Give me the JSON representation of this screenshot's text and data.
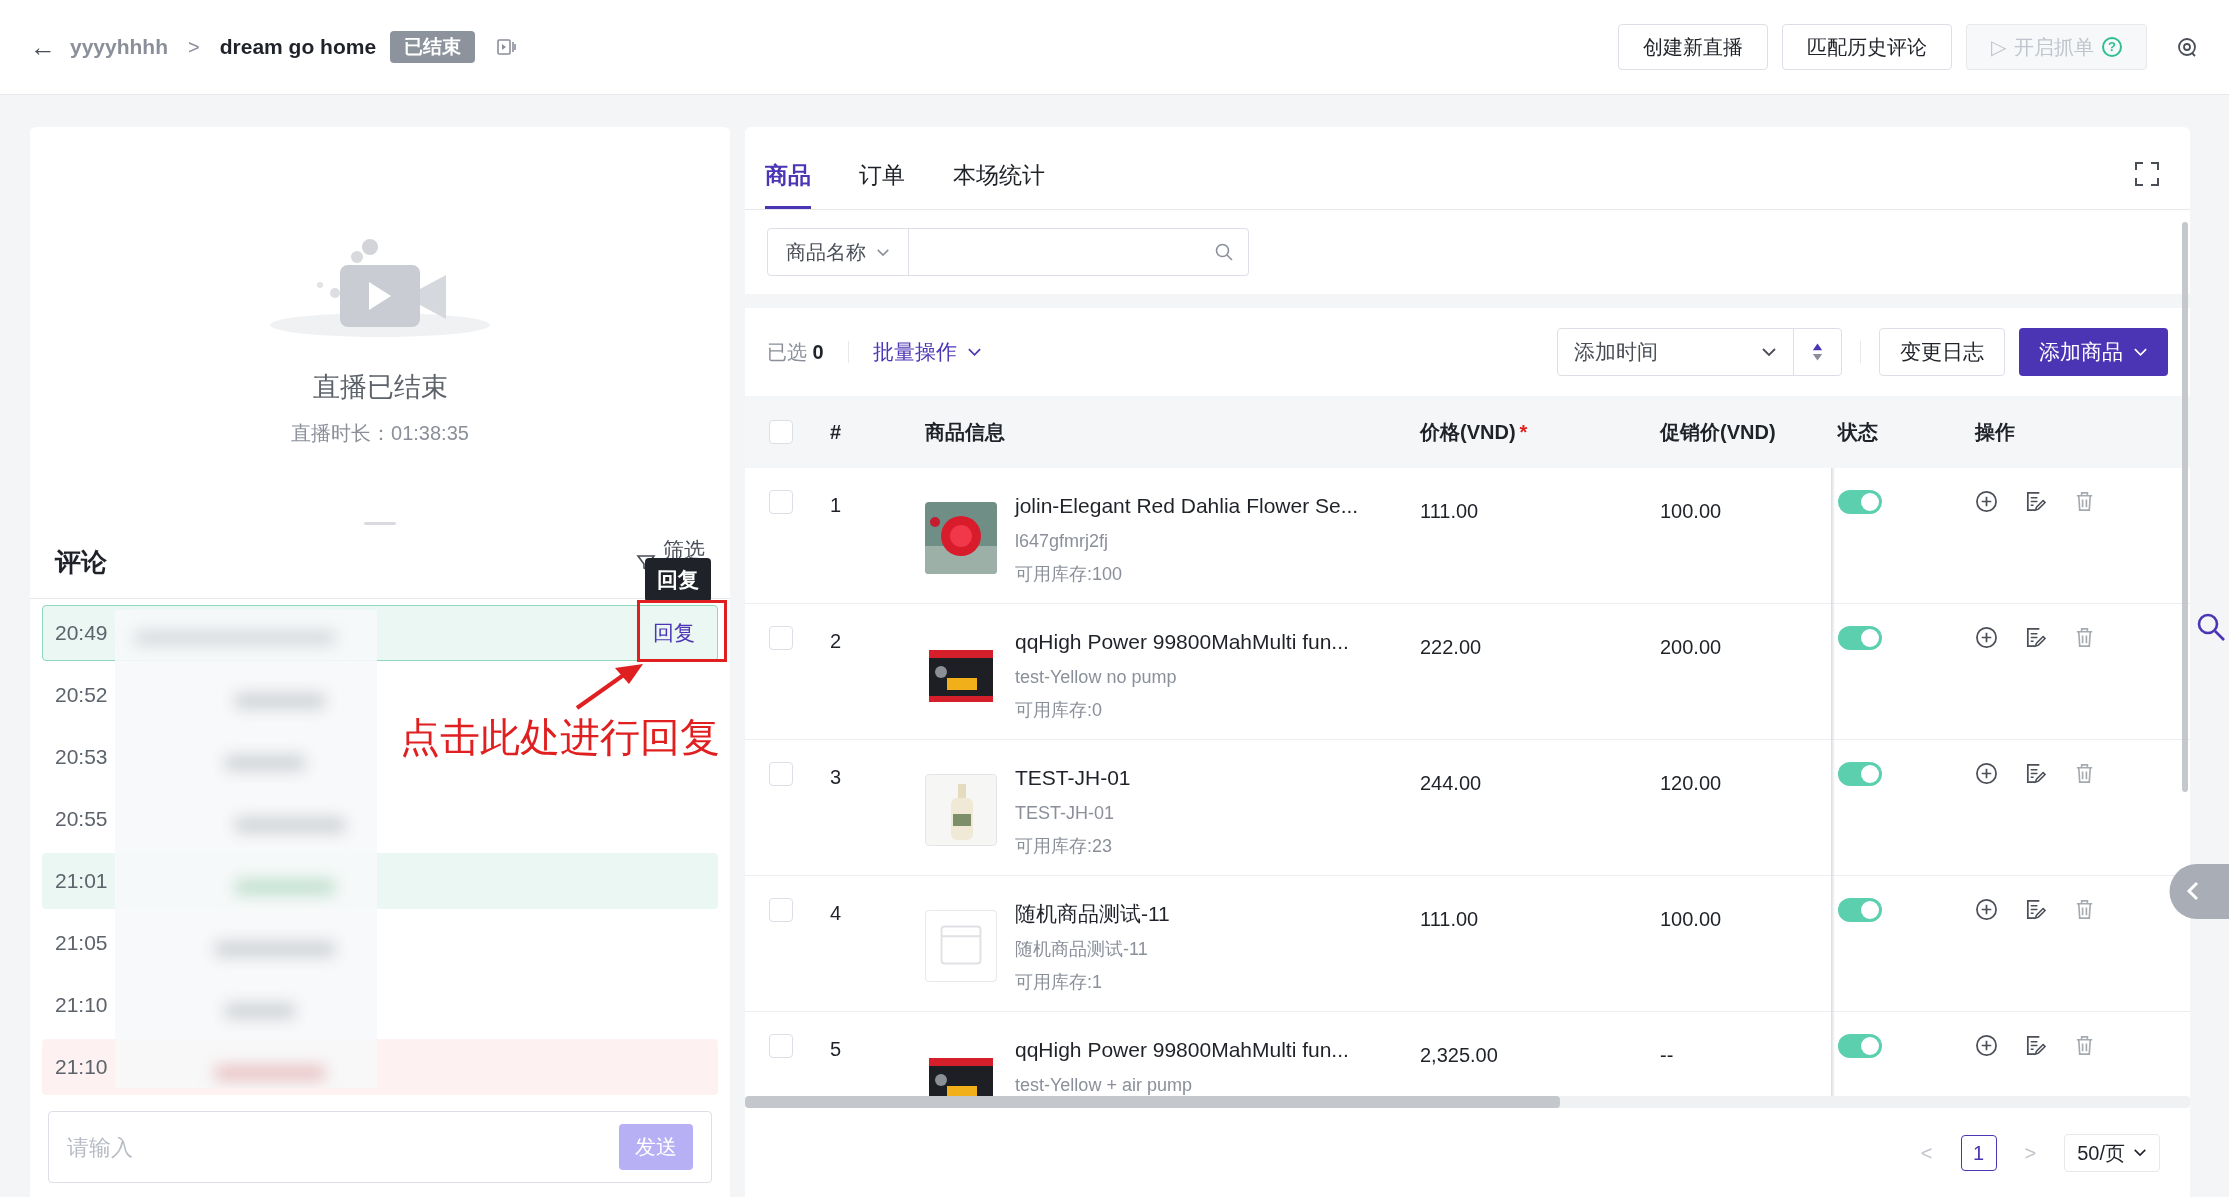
{
  "header": {
    "back": "←",
    "breadcrumb": "yyyyhhhh",
    "separator": ">",
    "title": "dream go home",
    "badge": "已结束",
    "buttons": [
      {
        "label": "创建新直播",
        "disabled": false
      },
      {
        "label": "匹配历史评论",
        "disabled": false
      },
      {
        "label": "开启抓单",
        "disabled": true,
        "icon": "▷",
        "help": "?"
      }
    ]
  },
  "live": {
    "status": "直播已结束",
    "duration": "直播时长：01:38:35"
  },
  "comments": {
    "title": "评论",
    "filter": "筛选",
    "tooltip": "回复",
    "reply": "回复",
    "items": [
      {
        "time": "20:49",
        "selected": true,
        "color": "#eaf7f2"
      },
      {
        "time": "20:52",
        "selected": false
      },
      {
        "time": "20:53",
        "selected": false
      },
      {
        "time": "20:55",
        "selected": false
      },
      {
        "time": "21:01",
        "selected": false,
        "color": "#eaf7f2"
      },
      {
        "time": "21:05",
        "selected": false
      },
      {
        "time": "21:10",
        "selected": false
      },
      {
        "time": "21:10",
        "selected": false,
        "color": "#fdf1f1"
      }
    ],
    "input_placeholder": "请输入",
    "send": "发送",
    "send_disabled": true
  },
  "annotation": {
    "text": "点击此处进行回复"
  },
  "tabs": [
    {
      "label": "商品",
      "selected": true
    },
    {
      "label": "订单",
      "selected": false
    },
    {
      "label": "本场统计",
      "selected": false
    }
  ],
  "search": {
    "field": "商品名称"
  },
  "toolbar": {
    "selected_label": "已选",
    "selected_count": "0",
    "batch": "批量操作",
    "sort": "添加时间",
    "log": "变更日志",
    "add": "添加商品"
  },
  "table": {
    "all_checked": false,
    "columns": [
      "#",
      "商品信息",
      "价格(VND)",
      "促销价(VND)",
      "状态",
      "操作"
    ],
    "required_mark": "*",
    "rows": [
      {
        "checked": false,
        "index": "1",
        "name": "jolin-Elegant Red Dahlia Flower Se...",
        "sku": "l647gfmrj2fj",
        "stock": "可用库存:100",
        "price": "111.00",
        "promo": "100.00",
        "on": true,
        "kind": "picture"
      },
      {
        "checked": false,
        "index": "2",
        "name": "qqHigh Power 99800MahMulti fun...",
        "sku": "test-Yellow no pump",
        "stock": "可用库存:0",
        "price": "222.00",
        "promo": "200.00",
        "on": true,
        "kind": "picture"
      },
      {
        "checked": false,
        "index": "3",
        "name": "TEST-JH-01",
        "sku": "TEST-JH-01",
        "stock": "可用库存:23",
        "price": "244.00",
        "promo": "120.00",
        "on": true,
        "kind": "picture"
      },
      {
        "checked": false,
        "index": "4",
        "name": "随机商品测试-11",
        "sku": "随机商品测试-11",
        "stock": "可用库存:1",
        "price": "111.00",
        "promo": "100.00",
        "on": true,
        "kind": "placeholder"
      },
      {
        "checked": false,
        "index": "5",
        "name": "qqHigh Power 99800MahMulti fun...",
        "sku": "test-Yellow + air pump",
        "price": "2,325.00",
        "promo": "--",
        "on": true,
        "kind": "picture"
      }
    ]
  },
  "pagination": {
    "prev": "<",
    "page": "1",
    "next": ">",
    "size": "50/页"
  }
}
